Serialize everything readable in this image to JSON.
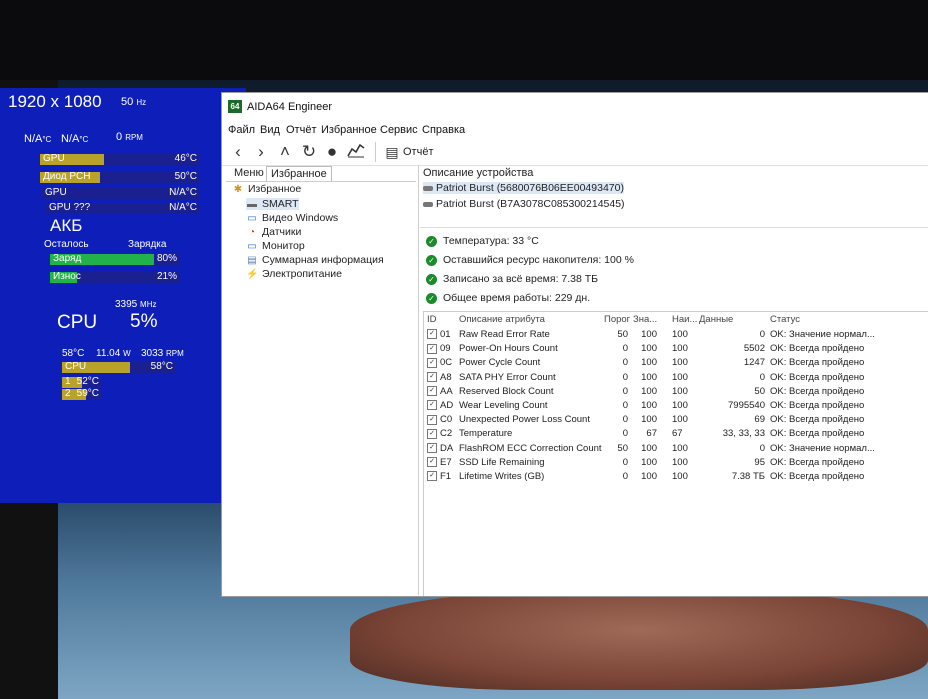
{
  "overlay": {
    "resolution": "1920 x 1080",
    "refresh": "50",
    "refresh_unit": "Hz",
    "na_left": "N/A",
    "na_left_unit": "°C",
    "na_right": "N/A",
    "na_right_unit": "°C",
    "rpm_val": "0",
    "rpm_unit": "RPM",
    "sensors": [
      {
        "label": "GPU",
        "value": "46°C",
        "fill": 0.8
      },
      {
        "label": "Диод PCH",
        "value": "50°C",
        "fill": 0.75
      },
      {
        "label": "GPU",
        "value": "N/A°C",
        "fill": 0.0
      },
      {
        "label": "GPU ???",
        "value": "N/A°C",
        "fill": 0.0
      }
    ],
    "battery_title": "АКБ",
    "remaining_label": "Осталось",
    "charging_label": "Зарядка",
    "charge": {
      "label": "Заряд",
      "value": "80%",
      "fill": 0.8
    },
    "wear": {
      "label": "Износ",
      "value": "21%",
      "fill": 0.21
    },
    "cpu_mhz": "3395",
    "cpu_mhz_unit": "MHz",
    "cpu_label": "CPU",
    "cpu_pct": "5%",
    "cpu_temp": "58°C",
    "cpu_power": "11.04",
    "cpu_power_unit": "W",
    "cpu_rpm": "3033",
    "cpu_rpm_unit": "RPM",
    "cpu_bar": {
      "label": "CPU",
      "value": "58°C",
      "fill": 0.6
    },
    "core_bars": [
      {
        "label": "1",
        "value": "52°C",
        "fill": 0.5
      },
      {
        "label": "2",
        "value": "59°C",
        "fill": 0.6
      }
    ]
  },
  "window": {
    "icon": "64",
    "title": "AIDA64 Engineer",
    "menu": [
      "Файл",
      "Вид",
      "Отчёт",
      "Избранное",
      "Сервис",
      "Справка"
    ],
    "toolbar_report": "Отчёт",
    "tabs": [
      "Меню",
      "Избранное"
    ],
    "tree": [
      {
        "label": "Избранное",
        "icon": "star-icon",
        "glyph": "✱",
        "color": "#d4901a"
      },
      {
        "label": "SMART",
        "icon": "drive-icon",
        "glyph": "▬",
        "color": "#666"
      },
      {
        "label": "Видео Windows",
        "icon": "monitor-icon",
        "glyph": "▭",
        "color": "#2a6fc0"
      },
      {
        "label": "Датчики",
        "icon": "sensor-icon",
        "glyph": "◔",
        "color": "#c0392b"
      },
      {
        "label": "Монитор",
        "icon": "monitor-icon",
        "glyph": "▭",
        "color": "#2a6fc0"
      },
      {
        "label": "Суммарная информация",
        "icon": "summary-icon",
        "glyph": "▤",
        "color": "#5a7ab0"
      },
      {
        "label": "Электропитание",
        "icon": "power-icon",
        "glyph": "⚡",
        "color": "#3a8a3a"
      }
    ],
    "device_header": "Описание устройства",
    "devices": [
      "Patriot Burst (5680076B06EE00493470)",
      "Patriot Burst (B7A3078C085300214545)"
    ],
    "summary": [
      "Температура: 33 °C",
      "Оставшийся ресурс накопителя: 100 %",
      "Записано за всё время: 7.38 ТБ",
      "Общее время работы: 229 дн."
    ],
    "table_headers": [
      "ID",
      "Описание атрибута",
      "Порог",
      "Зна...",
      "Наи...",
      "Данные",
      "Статус"
    ],
    "rows": [
      [
        "01",
        "Raw Read Error Rate",
        "50",
        "100",
        "100",
        "0",
        "OK: Значение нормал..."
      ],
      [
        "09",
        "Power-On Hours Count",
        "0",
        "100",
        "100",
        "5502",
        "OK: Всегда пройдено"
      ],
      [
        "0C",
        "Power Cycle Count",
        "0",
        "100",
        "100",
        "1247",
        "OK: Всегда пройдено"
      ],
      [
        "A8",
        "SATA PHY Error Count",
        "0",
        "100",
        "100",
        "0",
        "OK: Всегда пройдено"
      ],
      [
        "AA",
        "Reserved Block Count",
        "0",
        "100",
        "100",
        "50",
        "OK: Всегда пройдено"
      ],
      [
        "AD",
        "Wear Leveling Count",
        "0",
        "100",
        "100",
        "7995540",
        "OK: Всегда пройдено"
      ],
      [
        "C0",
        "Unexpected Power Loss Count",
        "0",
        "100",
        "100",
        "69",
        "OK: Всегда пройдено"
      ],
      [
        "C2",
        "Temperature",
        "0",
        "67",
        "67",
        "33, 33, 33",
        "OK: Всегда пройдено"
      ],
      [
        "DA",
        "FlashROM ECC Correction Count",
        "50",
        "100",
        "100",
        "0",
        "OK: Значение нормал..."
      ],
      [
        "E7",
        "SSD Life Remaining",
        "0",
        "100",
        "100",
        "95",
        "OK: Всегда пройдено"
      ],
      [
        "F1",
        "Lifetime Writes (GB)",
        "0",
        "100",
        "100",
        "7.38 ТБ",
        "OK: Всегда пройдено"
      ]
    ]
  }
}
